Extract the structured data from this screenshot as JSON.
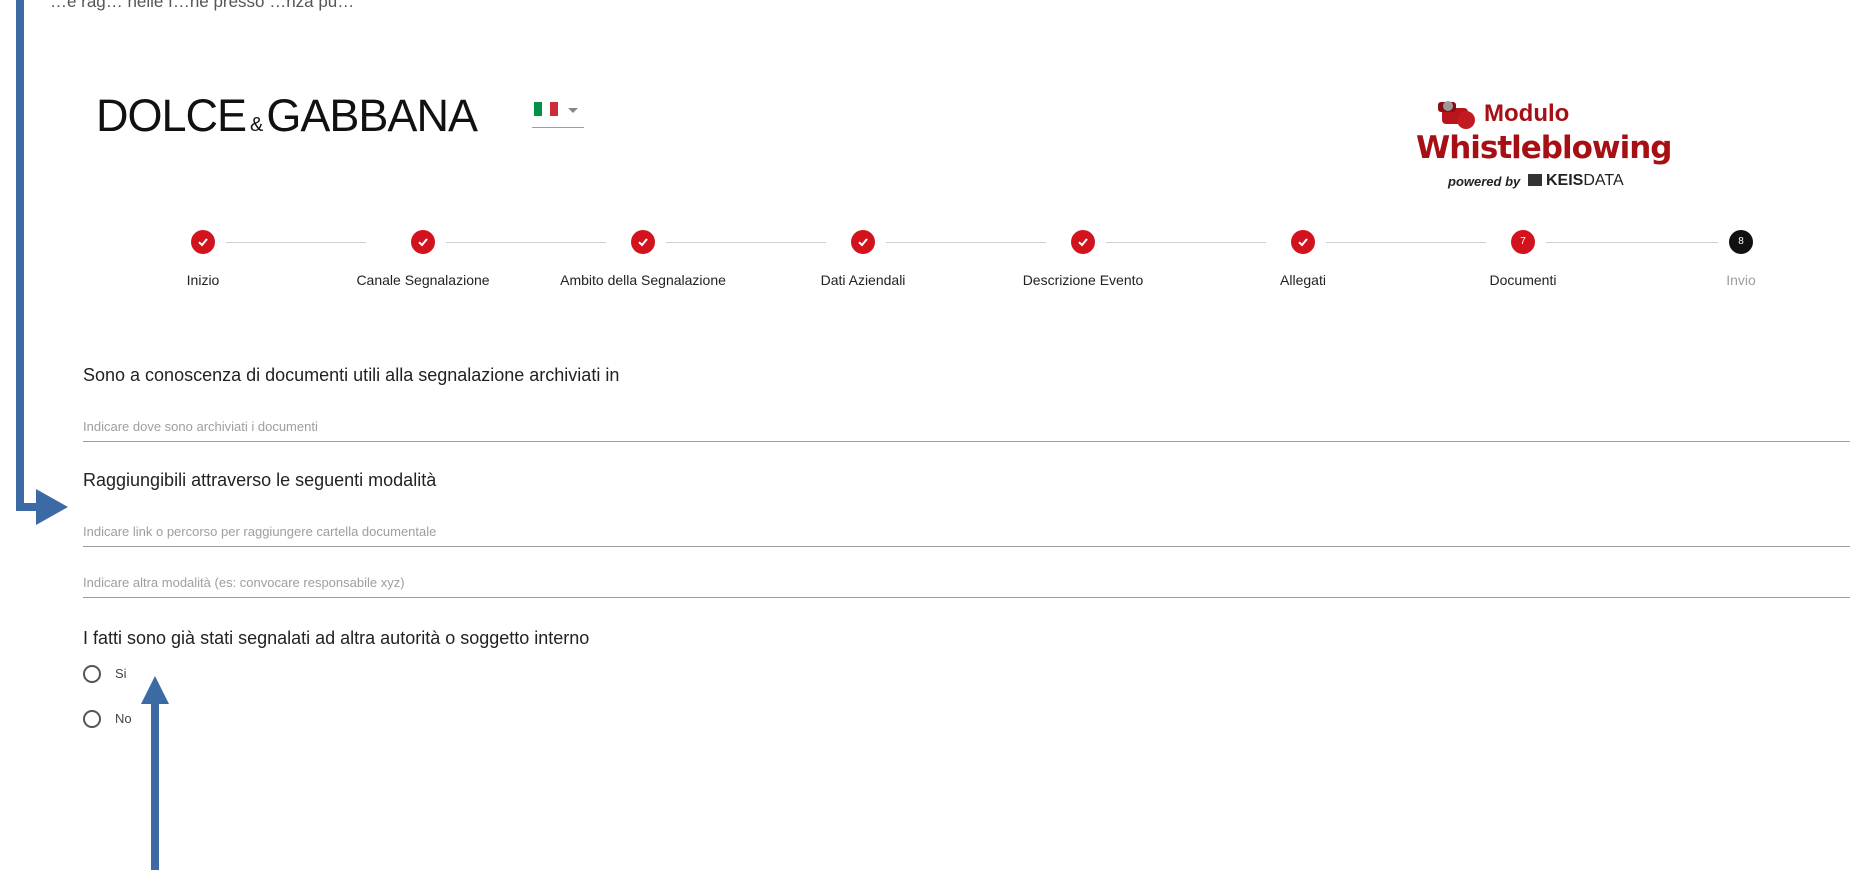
{
  "top_caption": "…e rag… nelle f…ne presso …nza pu…",
  "header": {
    "brand": {
      "left": "DOLCE",
      "amp": "&",
      "right": "GABBANA"
    },
    "language": {
      "flag": "italy-flag-icon",
      "colors": [
        "#009246",
        "#ffffff",
        "#ce2b37"
      ]
    },
    "whistleblowing_logo": {
      "line1": "Modulo",
      "line2": "Whistleblowing",
      "powered_by": "powered by",
      "vendor_bold": "KEIS",
      "vendor_rest": "DATA"
    }
  },
  "stepper": {
    "steps": [
      {
        "label": "Inizio",
        "state": "done"
      },
      {
        "label": "Canale Segnalazione",
        "state": "done"
      },
      {
        "label": "Ambito della Segnalazione",
        "state": "done"
      },
      {
        "label": "Dati Aziendali",
        "state": "done"
      },
      {
        "label": "Descrizione Evento",
        "state": "done"
      },
      {
        "label": "Allegati",
        "state": "done"
      },
      {
        "label": "Documenti",
        "state": "current",
        "number": "7"
      },
      {
        "label": "Invio",
        "state": "pending",
        "number": "8"
      }
    ]
  },
  "form": {
    "documents_title": "Sono a conoscenza di documenti utili alla segnalazione archiviati in",
    "documents_placeholder": "Indicare dove sono archiviati i documenti",
    "reachable_title": "Raggiungibili attraverso le seguenti modalità",
    "link_placeholder": "Indicare link o percorso per raggiungere cartella documentale",
    "other_placeholder": "Indicare altra modalità (es: convocare responsabile xyz)",
    "reported_title": "I fatti sono già stati segnalati ad altra autorità o soggetto interno",
    "reported_options": [
      "Si",
      "No"
    ]
  },
  "annotation_color": "#3b6aa5",
  "theme": {
    "accent": "#d2131e",
    "logo_red": "#a60f14"
  }
}
